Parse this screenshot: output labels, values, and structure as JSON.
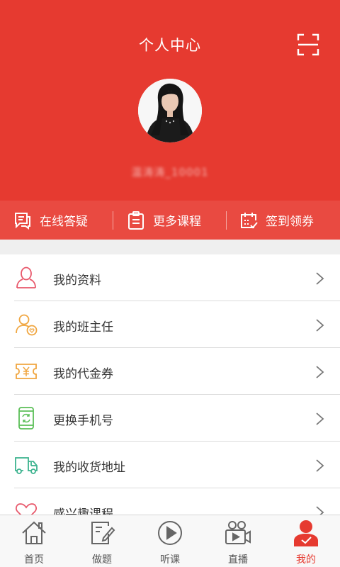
{
  "header": {
    "title": "个人中心",
    "username": "温涛涛_10001"
  },
  "actions": [
    {
      "label": "在线答疑",
      "icon": "chat-bubble-icon"
    },
    {
      "label": "更多课程",
      "icon": "clipboard-icon"
    },
    {
      "label": "签到领券",
      "icon": "calendar-check-icon"
    }
  ],
  "menu": [
    {
      "label": "我的资料",
      "icon": "user-profile-icon",
      "color": "#e8586b"
    },
    {
      "label": "我的班主任",
      "icon": "user-heart-icon",
      "color": "#f0a640"
    },
    {
      "label": "我的代金券",
      "icon": "voucher-yen-icon",
      "color": "#f0a640"
    },
    {
      "label": "更换手机号",
      "icon": "phone-refresh-icon",
      "color": "#5bbf58"
    },
    {
      "label": "我的收货地址",
      "icon": "delivery-truck-icon",
      "color": "#3cb38f"
    },
    {
      "label": "感兴趣课程",
      "icon": "heart-icon",
      "color": "#e8586b"
    }
  ],
  "tabs": [
    {
      "label": "首页",
      "icon": "home-icon",
      "active": false
    },
    {
      "label": "做题",
      "icon": "edit-note-icon",
      "active": false
    },
    {
      "label": "听课",
      "icon": "play-circle-icon",
      "active": false
    },
    {
      "label": "直播",
      "icon": "video-camera-icon",
      "active": false
    },
    {
      "label": "我的",
      "icon": "user-icon",
      "active": true
    }
  ],
  "colors": {
    "brand": "#e63a30",
    "action_bar": "#e94a41"
  }
}
